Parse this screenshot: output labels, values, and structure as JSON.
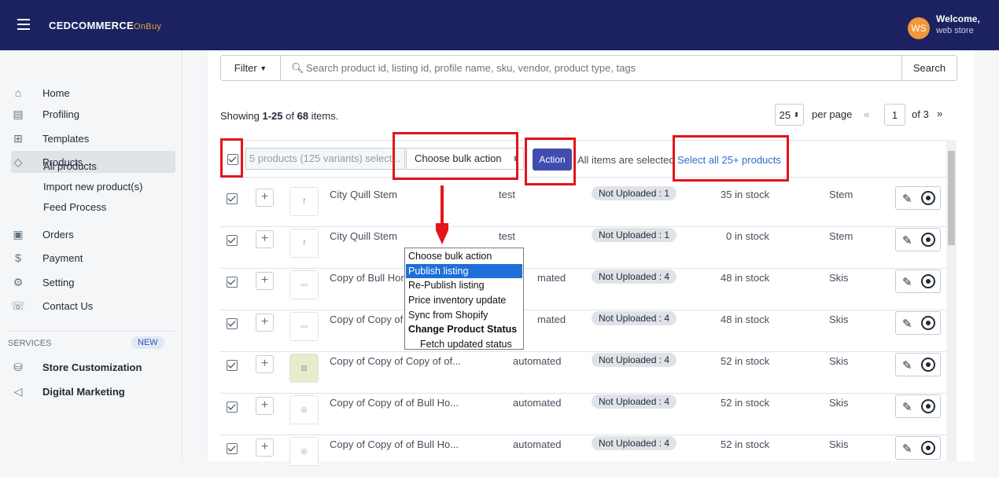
{
  "header": {
    "brand": "CEDCOMMERCE",
    "brand_sub": "OnBuy",
    "avatar": "WS",
    "welcome": "Welcome,",
    "user": "web store"
  },
  "sidebar": {
    "items": [
      {
        "label": "Home",
        "icon": "home-icon"
      },
      {
        "label": "Profiling",
        "icon": "profile-icon"
      },
      {
        "label": "Templates",
        "icon": "template-icon"
      },
      {
        "label": "Products",
        "icon": "tag-icon"
      }
    ],
    "product_sub": [
      "All products",
      "Import new product(s)",
      "Feed Process"
    ],
    "items2": [
      {
        "label": "Orders",
        "icon": "orders-icon"
      },
      {
        "label": "Payment",
        "icon": "dollar-icon"
      },
      {
        "label": "Setting",
        "icon": "gear-icon"
      },
      {
        "label": "Contact Us",
        "icon": "phone-icon"
      }
    ],
    "services_label": "SERVICES",
    "new_badge": "NEW",
    "services": [
      {
        "label": "Store Customization",
        "icon": "store-icon"
      },
      {
        "label": "Digital Marketing",
        "icon": "megaphone-icon"
      }
    ]
  },
  "filter": {
    "label": "Filter",
    "placeholder": "Search product id, listing id, profile name, sku, vendor, product type, tags",
    "search": "Search"
  },
  "summary": {
    "prefix": "Showing ",
    "range": "1-25",
    "mid": " of ",
    "total": "68",
    "suffix": " items."
  },
  "pagination": {
    "per_page": "25",
    "per_page_label": "per page",
    "prev": "«",
    "page": "1",
    "of": "of 3",
    "next": "»"
  },
  "bulk": {
    "selected": "5 products (125 variants) select...",
    "choose": "Choose bulk action",
    "action": "Action",
    "all_selected": "All items are selected",
    "select_all": "Select all 25+ products"
  },
  "dropdown": [
    "Choose bulk action",
    "Publish listing",
    "Re-Publish listing",
    "Price inventory update",
    "Sync from Shopify",
    "Change Product Status",
    "Fetch updated status"
  ],
  "rows": [
    {
      "title": "City Quill Stem",
      "vendor": "test",
      "status": "Not Uploaded : 1",
      "stock": "35 in stock",
      "type": "Stem"
    },
    {
      "title": "City Quill Stem",
      "vendor": "test",
      "status": "Not Uploaded : 1",
      "stock": "0 in stock",
      "type": "Stem"
    },
    {
      "title": "Copy of Bull Hor",
      "vendor": "mated",
      "status": "Not Uploaded : 4",
      "stock": "48 in stock",
      "type": "Skis"
    },
    {
      "title": "Copy of Copy of",
      "vendor": "mated",
      "status": "Not Uploaded : 4",
      "stock": "48 in stock",
      "type": "Skis"
    },
    {
      "title": "Copy of Copy of Copy of of...",
      "vendor": "automated",
      "status": "Not Uploaded : 4",
      "stock": "52 in stock",
      "type": "Skis"
    },
    {
      "title": "Copy of Copy of of Bull Ho...",
      "vendor": "automated",
      "status": "Not Uploaded : 4",
      "stock": "52 in stock",
      "type": "Skis"
    },
    {
      "title": "Copy of Copy of of Bull Ho...",
      "vendor": "automated",
      "status": "Not Uploaded : 4",
      "stock": "52 in stock",
      "type": "Skis"
    }
  ]
}
